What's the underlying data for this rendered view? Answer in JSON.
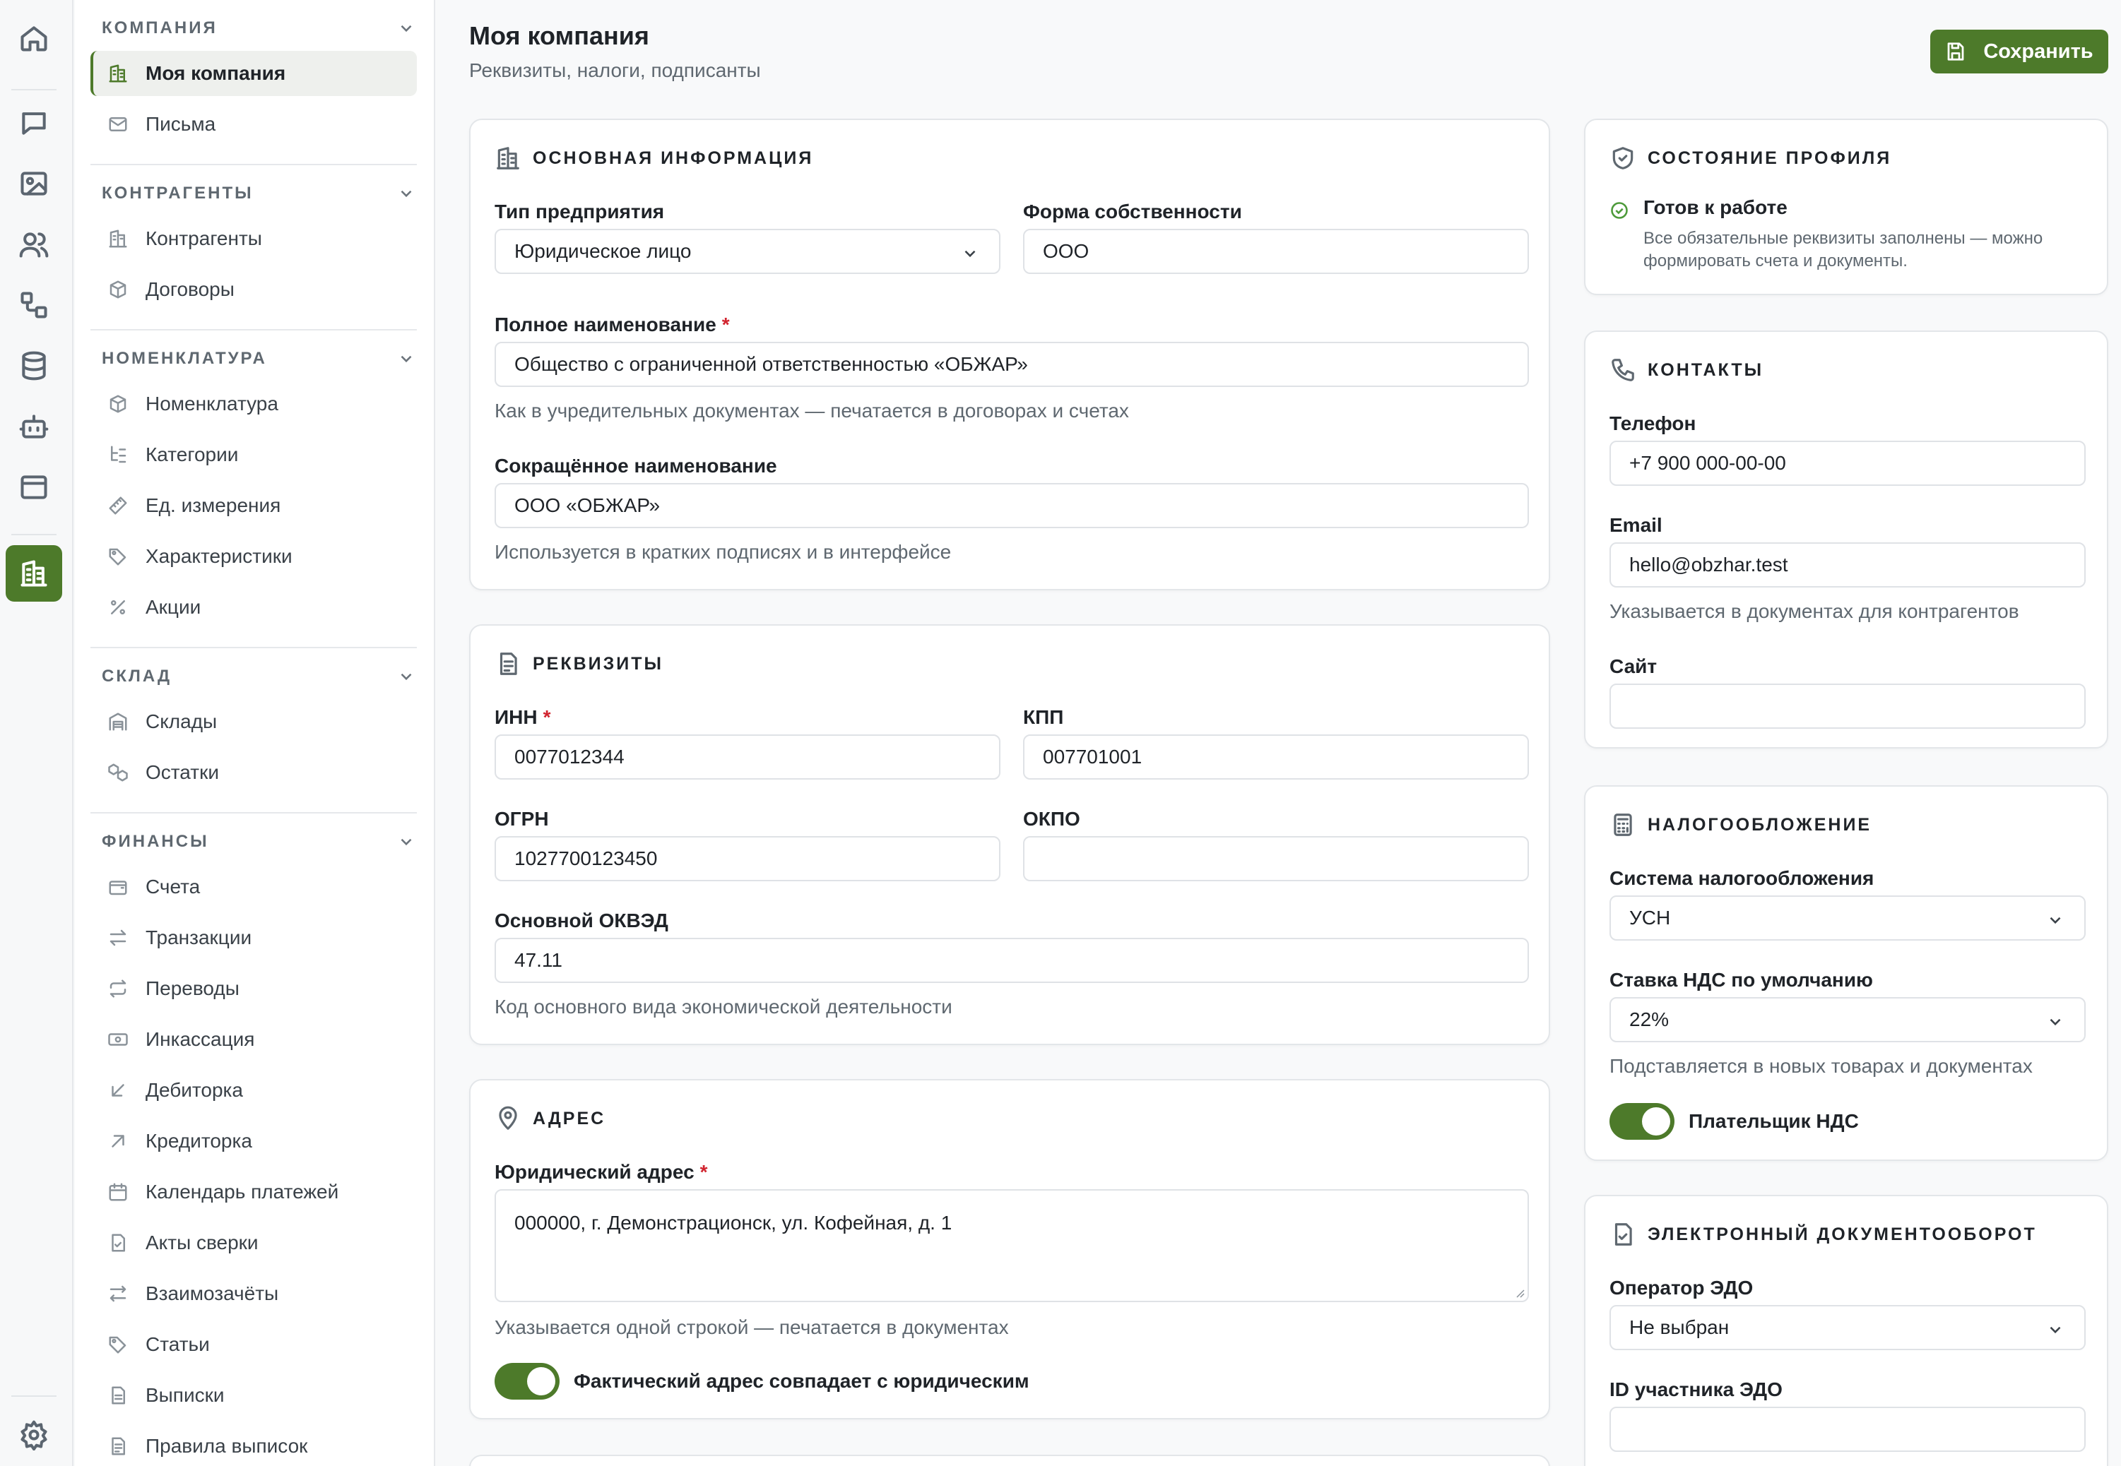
{
  "rail": {
    "icons": [
      "home-icon",
      "chat-icon",
      "image-icon",
      "users-icon",
      "workflow-icon",
      "database-icon",
      "bot-icon",
      "window-icon",
      "building-icon",
      "settings-icon"
    ]
  },
  "sidebar": {
    "groups": [
      {
        "title": "КОМПАНИЯ",
        "items": [
          {
            "label": "Моя компания",
            "icon": "building-icon"
          },
          {
            "label": "Письма",
            "icon": "mail-icon"
          }
        ]
      },
      {
        "title": "КОНТРАГЕНТЫ",
        "items": [
          {
            "label": "Контрагенты",
            "icon": "building-icon"
          },
          {
            "label": "Договоры",
            "icon": "box-icon"
          }
        ]
      },
      {
        "title": "НОМЕНКЛАТУРА",
        "items": [
          {
            "label": "Номенклатура",
            "icon": "box-icon"
          },
          {
            "label": "Категории",
            "icon": "tree-icon"
          },
          {
            "label": "Ед. измерения",
            "icon": "ruler-icon"
          },
          {
            "label": "Характеристики",
            "icon": "tags-icon"
          },
          {
            "label": "Акции",
            "icon": "percent-icon"
          }
        ]
      },
      {
        "title": "СКЛАД",
        "items": [
          {
            "label": "Склады",
            "icon": "warehouse-icon"
          },
          {
            "label": "Остатки",
            "icon": "boxes-icon"
          }
        ]
      },
      {
        "title": "ФИНАНСЫ",
        "items": [
          {
            "label": "Счета",
            "icon": "wallet-icon"
          },
          {
            "label": "Транзакции",
            "icon": "arrows-icon"
          },
          {
            "label": "Переводы",
            "icon": "repeat-icon"
          },
          {
            "label": "Инкассация",
            "icon": "banknote-icon"
          },
          {
            "label": "Дебиторка",
            "icon": "arrow-down-left-icon"
          },
          {
            "label": "Кредиторка",
            "icon": "arrow-up-right-icon"
          },
          {
            "label": "Календарь платежей",
            "icon": "calendar-icon"
          },
          {
            "label": "Акты сверки",
            "icon": "file-check-icon"
          },
          {
            "label": "Взаимозачёты",
            "icon": "swap-icon"
          },
          {
            "label": "Статьи",
            "icon": "tag-icon"
          },
          {
            "label": "Выписки",
            "icon": "file-icon"
          },
          {
            "label": "Правила выписок",
            "icon": "file-text-icon"
          }
        ]
      }
    ]
  },
  "header": {
    "title": "Моя компания",
    "subtitle": "Реквизиты, налоги, подписанты",
    "save_label": "Сохранить"
  },
  "main": {
    "basic": {
      "title": "ОСНОВНАЯ ИНФОРМАЦИЯ",
      "type_label": "Тип предприятия",
      "type_value": "Юридическое лицо",
      "ownership_label": "Форма собственности",
      "ownership_value": "ООО",
      "full_name_label": "Полное наименование",
      "full_name_value": "Общество с ограниченной ответственностью «ОБЖАР»",
      "full_name_hint": "Как в учредительных документах — печатается в договорах и счетах",
      "short_name_label": "Сокращённое наименование",
      "short_name_value": "ООО «ОБЖАР»",
      "short_name_hint": "Используется в кратких подписях и в интерфейсе",
      "required_mark": "*"
    },
    "requisites": {
      "title": "РЕКВИЗИТЫ",
      "inn_label": "ИНН",
      "inn_value": "0077012344",
      "kpp_label": "КПП",
      "kpp_value": "007701001",
      "ogrn_label": "ОГРН",
      "ogrn_value": "1027700123450",
      "okpo_label": "ОКПО",
      "okpo_value": "",
      "okved_label": "Основной ОКВЭД",
      "okved_value": "47.11",
      "okved_hint": "Код основного вида экономической деятельности"
    },
    "address": {
      "title": "АДРЕС",
      "legal_label": "Юридический адрес",
      "legal_value": "000000, г. Демонстрационск, ул. Кофейная, д. 1",
      "legal_hint": "Указывается одной строкой — печатается в документах",
      "same_toggle_label": "Фактический адрес совпадает с юридическим",
      "same_toggle_on": true
    }
  },
  "right": {
    "status": {
      "title": "СОСТОЯНИЕ ПРОФИЛЯ",
      "state": "Готов к работе",
      "description": "Все обязательные реквизиты заполнены — можно формировать счета и документы."
    },
    "contacts": {
      "title": "КОНТАКТЫ",
      "phone_label": "Телефон",
      "phone_value": "+7 900 000-00-00",
      "email_label": "Email",
      "email_value": "hello@obzhar.test",
      "email_hint": "Указывается в документах для контрагентов",
      "site_label": "Сайт",
      "site_value": ""
    },
    "tax": {
      "title": "НАЛОГООБЛОЖЕНИЕ",
      "system_label": "Система налогообложения",
      "system_value": "УСН",
      "vat_label": "Ставка НДС по умолчанию",
      "vat_value": "22%",
      "vat_hint": "Подставляется в новых товарах и документах",
      "vat_payer_label": "Плательщик НДС",
      "vat_payer_on": true
    },
    "edo": {
      "title": "ЭЛЕКТРОННЫЙ ДОКУМЕНТООБОРОТ",
      "operator_label": "Оператор ЭДО",
      "operator_value": "Не выбран",
      "participant_label": "ID участника ЭДО",
      "participant_value": ""
    }
  },
  "colors": {
    "accent": "#4d7a2a",
    "required": "#d1242f",
    "muted": "#5f6870",
    "border": "#dfe2e6"
  }
}
